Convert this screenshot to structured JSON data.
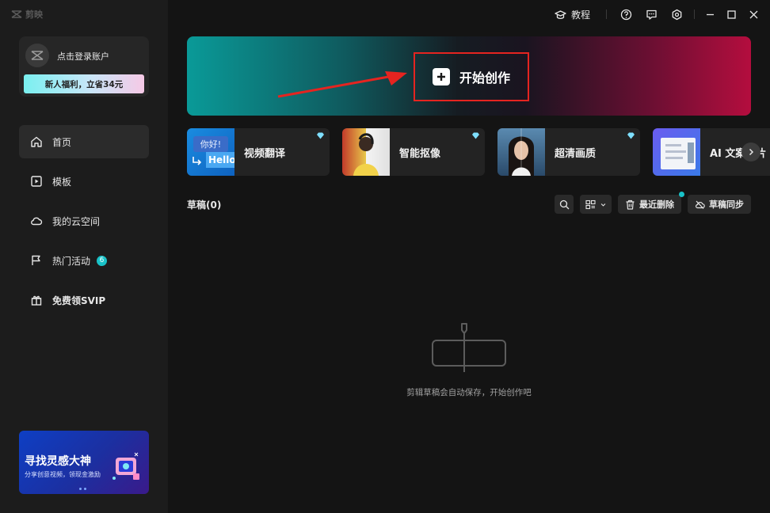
{
  "app": {
    "logo_text": "剪映"
  },
  "titlebar": {
    "tutorial_label": "教程"
  },
  "account": {
    "login_text": "点击登录账户",
    "promo_text": "新人福利，立省34元"
  },
  "nav": {
    "items": [
      {
        "label": "首页",
        "icon": "home-icon",
        "active": true
      },
      {
        "label": "模板",
        "icon": "template-icon"
      },
      {
        "label": "我的云空间",
        "icon": "cloud-icon"
      },
      {
        "label": "热门活动",
        "icon": "flag-icon",
        "badge": "6"
      },
      {
        "label": "免费领SVIP",
        "icon": "gift-icon"
      }
    ]
  },
  "bottom_banner": {
    "title": "寻找灵感大神",
    "subtitle": "分享创意视频，领现金激励"
  },
  "hero": {
    "create_label": "开始创作"
  },
  "features": [
    {
      "label": "视频翻译",
      "thumb_text_1": "你好!",
      "thumb_text_2": "Hello"
    },
    {
      "label": "智能抠像"
    },
    {
      "label": "超清画质"
    },
    {
      "label": "AI 文案成片"
    }
  ],
  "drafts": {
    "title": "草稿(0)",
    "recent_delete_label": "最近删除",
    "sync_label": "草稿同步",
    "empty_text": "剪辑草稿会自动保存，开始创作吧"
  },
  "colors": {
    "accent": "#19c2c8",
    "highlight_border": "#e52420"
  }
}
